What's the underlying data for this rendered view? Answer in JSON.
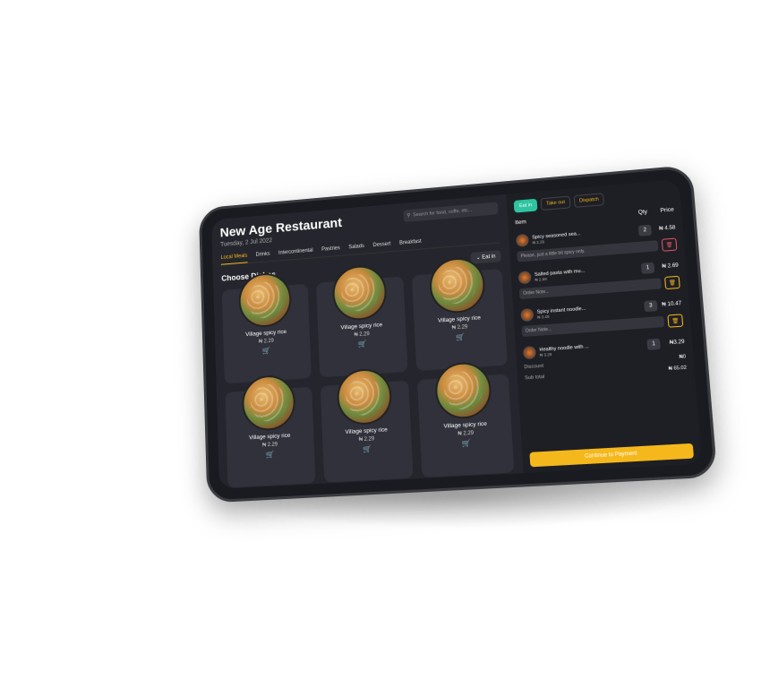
{
  "restaurant": {
    "name": "New Age Restaurant",
    "date": "Tuesday, 2 Jul 2022"
  },
  "search": {
    "placeholder": "Search for food, coffe, etc..."
  },
  "categories": [
    "Local Meals",
    "Drinks",
    "Intercontinental",
    "Pastries",
    "Salads",
    "Dessert",
    "Breakfast"
  ],
  "menu": {
    "heading": "Choose Dishes",
    "dine_mode": "Eat in",
    "dishes": [
      {
        "name": "Village spicy rice",
        "price": "₦ 2.29"
      },
      {
        "name": "Village spicy rice",
        "price": "₦ 2.29"
      },
      {
        "name": "Village spicy rice",
        "price": "₦ 2.29"
      },
      {
        "name": "Village spicy rice",
        "price": "₦ 2.29"
      },
      {
        "name": "Village spicy rice",
        "price": "₦ 2.29"
      },
      {
        "name": "Village spicy rice",
        "price": "₦ 2.29"
      }
    ]
  },
  "order": {
    "tabs": [
      "Eat in",
      "Take out",
      "Dispatch"
    ],
    "col_item": "Item",
    "col_qty": "Qty",
    "col_price": "Price",
    "items": [
      {
        "name": "Spicy seasoned sea...",
        "unit": "₦ 2.29",
        "qty": "2",
        "total": "₦ 4.58",
        "note": "Please, just a little bit spicy only."
      },
      {
        "name": "Salted pasta with mu...",
        "unit": "₦ 2.69",
        "qty": "1",
        "total": "₦ 2.69",
        "note": "Order Note..."
      },
      {
        "name": "Spicy instant noodle...",
        "unit": "₦ 3.49",
        "qty": "3",
        "total": "₦ 10.47",
        "note": "Order Note..."
      },
      {
        "name": "Healthy noodle with ...",
        "unit": "₦ 3.29",
        "qty": "1",
        "total": "₦3.29",
        "note": ""
      }
    ],
    "discount_label": "Discount",
    "discount": "₦0",
    "subtotal_label": "Sub total",
    "subtotal": "₦ 65.02",
    "pay_label": "Continue to Payment"
  },
  "colors": {
    "accent": "#f5b81c",
    "green": "#2ec4a0",
    "danger": "#e05569"
  }
}
